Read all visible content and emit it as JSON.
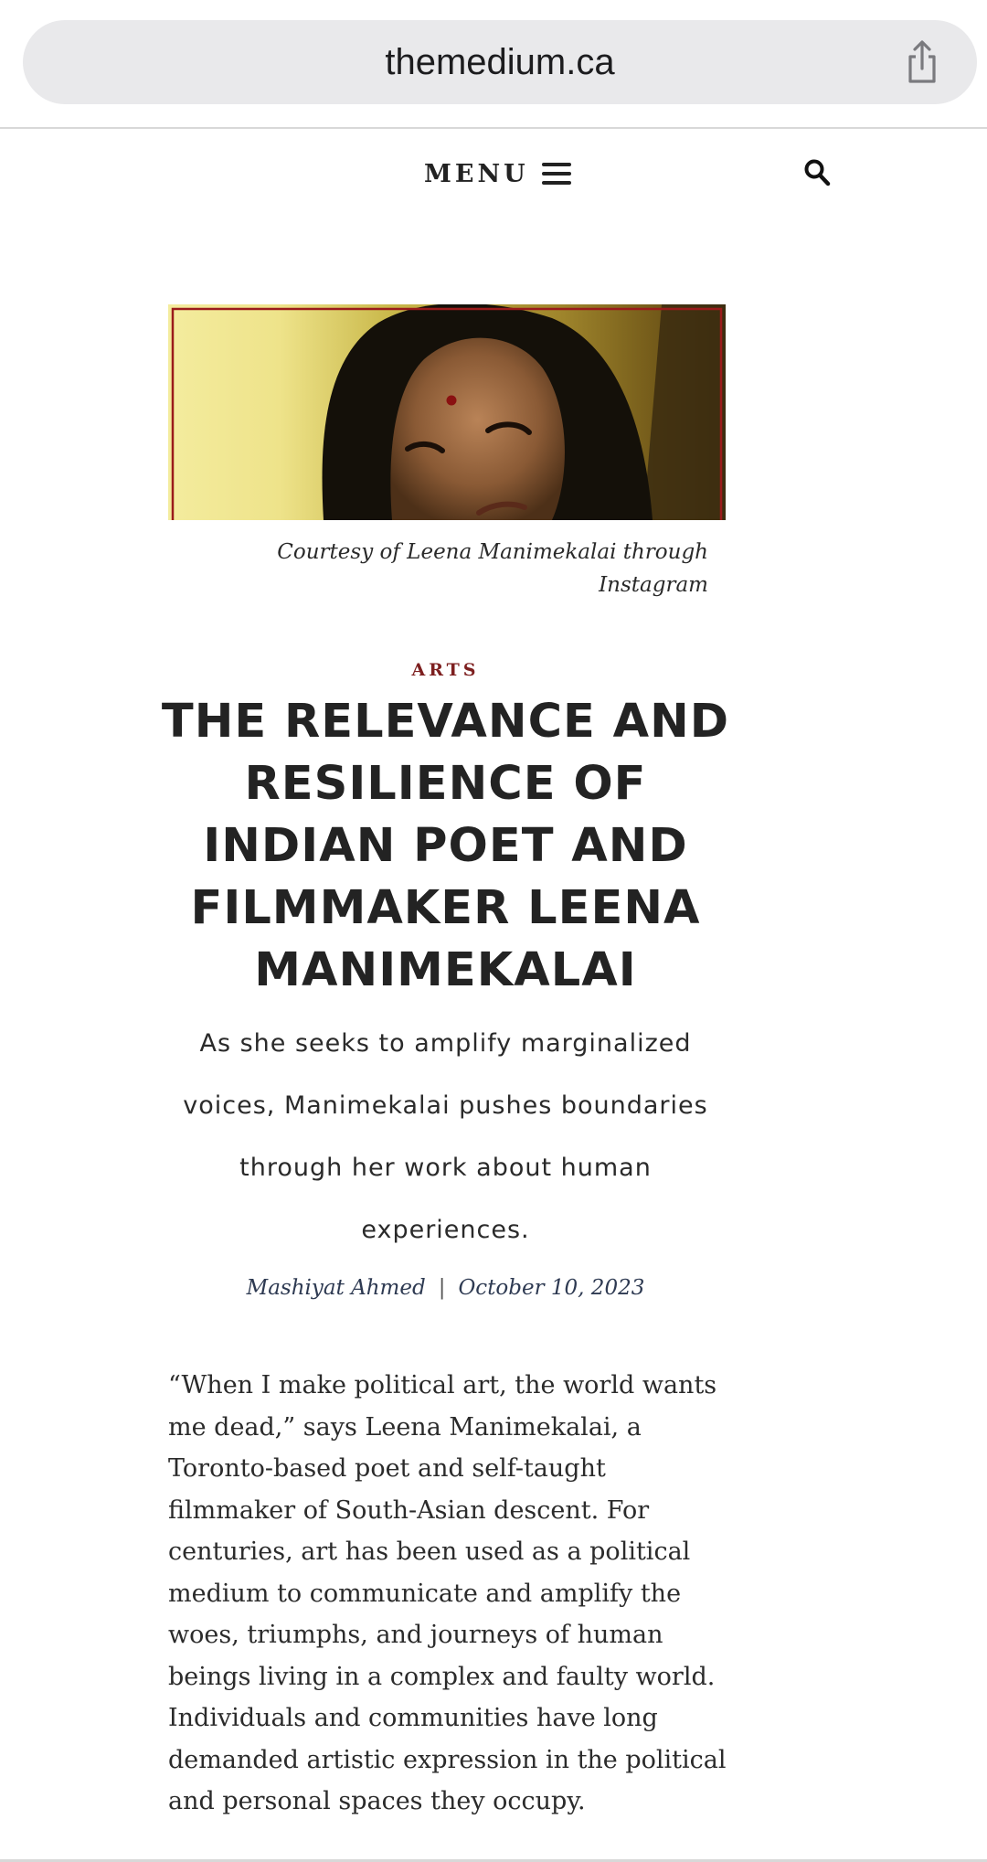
{
  "browser": {
    "url": "themedium.ca",
    "share_icon": "share-icon"
  },
  "header": {
    "menu_label": "MENU",
    "menu_icon": "hamburger-icon",
    "search_icon": "search-icon"
  },
  "hero": {
    "caption": "Courtesy of Leena Manimekalai through Instagram"
  },
  "article": {
    "category": "ARTS",
    "title": "THE RELEVANCE AND RESILIENCE OF INDIAN POET AND FILMMAKER LEENA MANIMEKALAI",
    "subtitle": "As she seeks to amplify marginalized voices, Manimekalai pushes boundaries through her work about human experiences.",
    "author": "Mashiyat Ahmed",
    "separator": "|",
    "date": "October 10, 2023",
    "body": "“When I make political art, the world wants me dead,” says Leena Manimekalai, a Toronto-based poet and self-taught filmmaker of South-Asian descent. For centuries, art has been used as a political medium to communicate and amplify the woes, triumphs, and journeys of human beings living in a complex and faulty world. Individuals and communities have long demanded artistic expression in the political and personal spaces they occupy."
  },
  "colors": {
    "category": "#7d1f1f",
    "url_bar": "#e9e9eb",
    "byline": "#2e3a52"
  }
}
